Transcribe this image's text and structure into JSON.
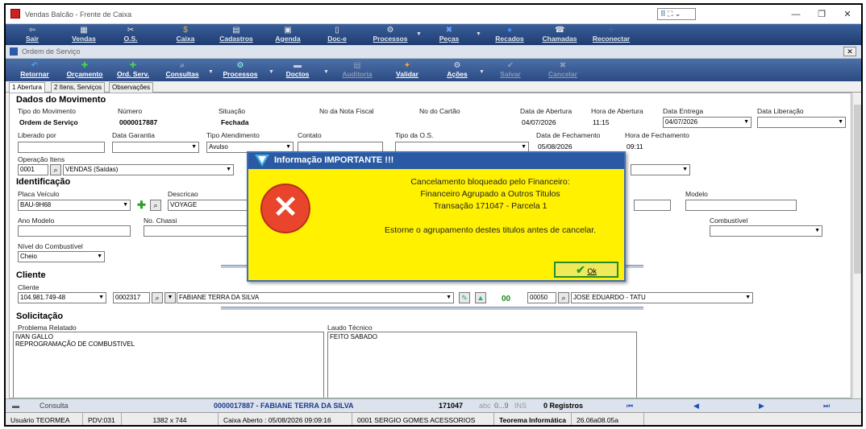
{
  "window": {
    "title": "Vendas Balcão - Frente de Caixa",
    "layout_selector": "⠿ ⛶ ⌄"
  },
  "main_toolbar": [
    {
      "label": "Sair",
      "icon": "exit-icon"
    },
    {
      "label": "Vendas",
      "icon": "sales-icon"
    },
    {
      "label": "O.S.",
      "icon": "tools-icon"
    },
    {
      "label": "Caixa",
      "icon": "cash-icon"
    },
    {
      "label": "Cadastros",
      "icon": "register-icon"
    },
    {
      "label": "Agenda",
      "icon": "calendar-icon"
    },
    {
      "label": "Doc-e",
      "icon": "document-icon"
    },
    {
      "label": "Processos",
      "icon": "process-icon"
    },
    {
      "label": "Peças",
      "icon": "parts-icon"
    },
    {
      "label": "Recados",
      "icon": "message-icon"
    },
    {
      "label": "Chamadas",
      "icon": "call-icon"
    },
    {
      "label": "Reconectar",
      "icon": "reconnect-icon"
    }
  ],
  "child_window": {
    "title": "Ordem de Serviço"
  },
  "os_toolbar": [
    {
      "label": "Retornar",
      "icon": "back-icon",
      "enabled": true
    },
    {
      "label": "Orçamento",
      "icon": "plus-icon",
      "enabled": true
    },
    {
      "label": "Ord. Serv.",
      "icon": "plus-icon",
      "enabled": true
    },
    {
      "label": "Consultas",
      "icon": "search-icon",
      "enabled": true
    },
    {
      "label": "Processos",
      "icon": "process-icon",
      "enabled": true
    },
    {
      "label": "Doctos",
      "icon": "print-icon",
      "enabled": true
    },
    {
      "label": "Auditoria",
      "icon": "audit-icon",
      "enabled": false
    },
    {
      "label": "Validar",
      "icon": "validate-icon",
      "enabled": true
    },
    {
      "label": "Ações",
      "icon": "actions-icon",
      "enabled": true
    },
    {
      "label": "Salvar",
      "icon": "check-icon",
      "enabled": false
    },
    {
      "label": "Cancelar",
      "icon": "cancel-icon",
      "enabled": false
    }
  ],
  "tabs": [
    "1 Abertura",
    "2 Itens, Serviços",
    "Observações"
  ],
  "movimento": {
    "section": "Dados do Movimento",
    "tipo_label": "Tipo do Movimento",
    "tipo": "Ordem de Serviço",
    "numero_label": "Número",
    "numero": "0000017887",
    "situacao_label": "Situação",
    "situacao": "Fechada",
    "nf_label": "No da Nota Fiscal",
    "cartao_label": "No do Cartão",
    "abertura_label": "Data de Abertura",
    "abertura": "04/07/2026",
    "hora_abertura_label": "Hora de Abertura",
    "hora_abertura": "11:15",
    "entrega_label": "Data Entrega",
    "entrega": "04/07/2026",
    "liberacao_label": "Data Liberação",
    "liberado_label": "Liberado por",
    "garantia_label": "Data Garantia",
    "atendimento_label": "Tipo Atendimento",
    "atendimento": "Avulso",
    "contato_label": "Contato",
    "tipo_os_label": "Tipo da O.S.",
    "fechamento_label": "Data de Fechamento",
    "fechamento": "05/08/2026",
    "hora_fechamento_label": "Hora de Fechamento",
    "hora_fechamento": "09:11",
    "operacao_label": "Operação Itens",
    "operacao_code": "0001",
    "operacao": "VENDAS (Saídas)"
  },
  "identificacao": {
    "section": "Identificação",
    "placa_label": "Placa Veículo",
    "placa": "BAU-9H68",
    "descricao_label": "Descricao",
    "descricao": "VOYAGE",
    "modelo_label": "Modelo",
    "ano_label": "Ano Modelo",
    "chassi_label": "No. Chassi",
    "combustivel_label": "Combustível",
    "nivel_label": "Nível do Combustível",
    "nivel": "Cheio"
  },
  "cliente": {
    "section": "Cliente",
    "cliente_label": "Cliente",
    "cpf": "104.981.749-48",
    "codigo": "0002317",
    "nome": "FABIANE TERRA DA SILVA",
    "situacao": "00",
    "vendedor_code": "00050",
    "vendedor": "JOSE EDUARDO - TATU"
  },
  "solicitacao": {
    "section": "Solicitação",
    "problema_label": "Problema Relatado",
    "problema": "IVAN GALLO\nREPROGRAMAÇÃO DE COMBUSTIVEL",
    "laudo_label": "Laudo Técnico",
    "laudo": "FEITO SABADO"
  },
  "navbar": {
    "mode": "Consulta",
    "record": "0000017887 - FABIANE TERRA DA SILVA",
    "trans": "171047",
    "abc": "abc",
    "range": "0...9",
    "ins": "INS",
    "count": "0 Registros",
    "first": "⏮",
    "prev": "◀",
    "next": "▶",
    "last": "⏭"
  },
  "status": {
    "user": "Usuário TEORMEA",
    "pdv": "PDV:031",
    "res": "1382 x 744",
    "caixa": "Caixa Aberto : 05/08/2026 09:09:16",
    "empresa": "0001 SERGIO GOMES ACESSORIOS",
    "software": "Teorema Informática",
    "version": "26.06a08.05a"
  },
  "dialog": {
    "title": "Informação IMPORTANTE !!!",
    "line1": "Cancelamento bloqueado pelo Financeiro:",
    "line2": "Financeiro Agrupado a Outros Titulos",
    "line3": "Transação 171047 - Parcela 1",
    "line4": "Estorne o agrupamento destes titulos antes de cancelar.",
    "ok": "Ok",
    "bg_color": "#fff100",
    "icon_color": "#e8452c"
  }
}
